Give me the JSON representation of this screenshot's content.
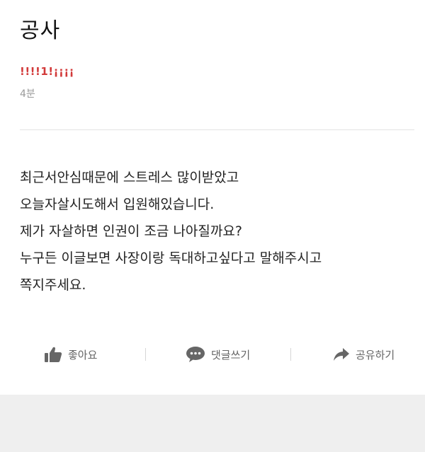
{
  "post": {
    "title": "공사",
    "author": "!!!!1!¡¡¡¡",
    "time": "4분",
    "body_lines": [
      "최근서안심때문에 스트레스 많이받았고",
      "오늘자살시도해서 입원해있습니다.",
      "제가 자살하면 인권이 조금 나아질까요?",
      "누구든 이글보면 사장이랑 독대하고싶다고 말해주시고",
      "쪽지주세요."
    ]
  },
  "actions": {
    "like_label": "좋아요",
    "comment_label": "댓글쓰기",
    "share_label": "공유하기"
  },
  "colors": {
    "author": "#d23a3a",
    "icon": "#666666",
    "footer": "#efefef"
  }
}
